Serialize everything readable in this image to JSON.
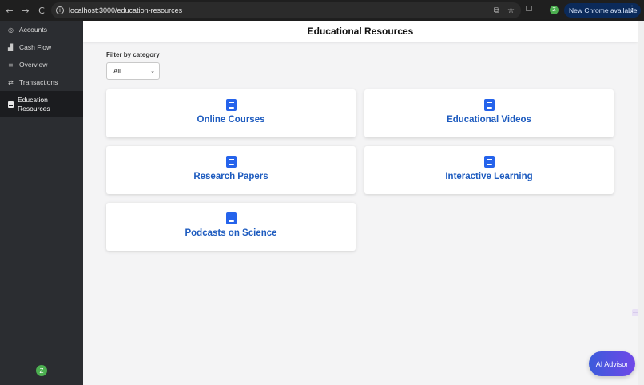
{
  "browser": {
    "url": "localhost:3000/education-resources",
    "update_label": "New Chrome available",
    "profile_initial": "Z",
    "back_icon": "←",
    "forward_icon": "→",
    "reload_icon": "C",
    "info_icon": "i",
    "menu_icon": "⋮"
  },
  "sidebar": {
    "items": [
      {
        "label": "Accounts",
        "icon": "◎"
      },
      {
        "label": "Cash Flow",
        "icon": "▟"
      },
      {
        "label": "Overview",
        "icon": "≡"
      },
      {
        "label": "Transactions",
        "icon": "⇄"
      },
      {
        "label": "Education Resources",
        "icon": "book"
      }
    ],
    "avatar_initial": "Z"
  },
  "main": {
    "title": "Educational Resources",
    "filter": {
      "label": "Filter by category",
      "selected": "All"
    },
    "cards": [
      {
        "title": "Online Courses"
      },
      {
        "title": "Educational Videos"
      },
      {
        "title": "Research Papers"
      },
      {
        "title": "Interactive Learning"
      },
      {
        "title": "Podcasts on Science"
      }
    ]
  },
  "ai_button": {
    "label": "AI Advisor"
  },
  "colors": {
    "sidebar_bg": "#2b2d31",
    "card_title": "#1d5bbf",
    "book_icon": "#2563eb",
    "ai_gradient_start": "#3b5bdb",
    "ai_gradient_end": "#7048e8"
  }
}
